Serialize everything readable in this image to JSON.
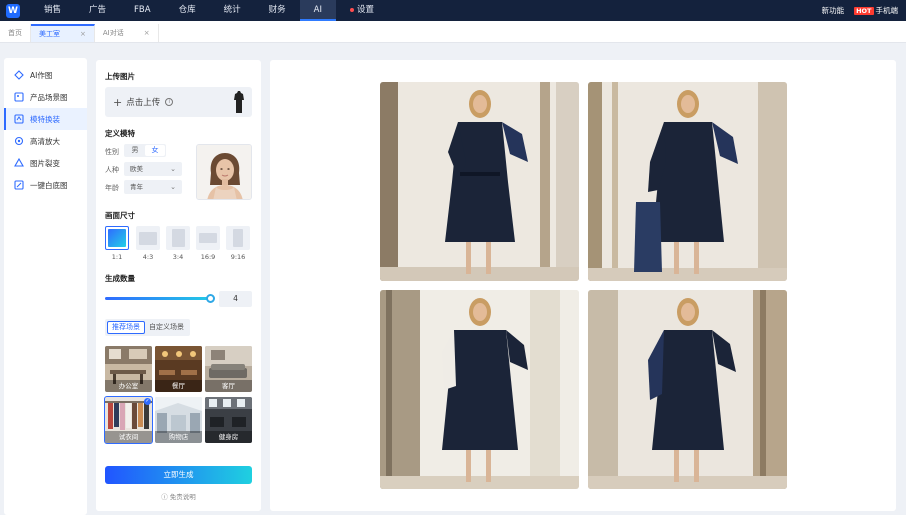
{
  "topnav": {
    "items": [
      {
        "label": "销售"
      },
      {
        "label": "广告"
      },
      {
        "label": "FBA"
      },
      {
        "label": "仓库"
      },
      {
        "label": "统计"
      },
      {
        "label": "财务"
      },
      {
        "label": "AI"
      },
      {
        "label": "设置"
      }
    ],
    "active": "AI",
    "right": {
      "new_feature": "新功能",
      "hot_badge": "HOT",
      "mobile": "手机端"
    }
  },
  "tabs": [
    {
      "label": "首页"
    },
    {
      "label": "美工室",
      "closable": true
    },
    {
      "label": "AI对话",
      "closable": true
    }
  ],
  "active_tab": "美工室",
  "sidebar": {
    "items": [
      {
        "label": "AI作图",
        "icon": "ai-draw-icon"
      },
      {
        "label": "产品场景图",
        "icon": "product-scene-icon"
      },
      {
        "label": "模特换装",
        "icon": "model-swap-icon"
      },
      {
        "label": "高清放大",
        "icon": "upscale-icon"
      },
      {
        "label": "图片裂变",
        "icon": "image-fission-icon"
      },
      {
        "label": "一键白底图",
        "icon": "white-bg-icon"
      }
    ],
    "active": "模特换装"
  },
  "config": {
    "upload_title": "上传图片",
    "upload_label": "点击上传",
    "model_title": "定义模特",
    "gender_label": "性别",
    "gender_options": [
      "男",
      "女"
    ],
    "gender_selected": "女",
    "race_label": "人种",
    "race_value": "欧美",
    "age_label": "年龄",
    "age_value": "青年",
    "size_title": "画面尺寸",
    "ratios": [
      "1:1",
      "4:3",
      "3:4",
      "16:9",
      "9:16"
    ],
    "ratio_selected": "1:1",
    "count_title": "生成数量",
    "count_value": "4",
    "count_fraction": 1.0,
    "scene_tabs": [
      "推荐场景",
      "自定义场景"
    ],
    "scene_tab_selected": "推荐场景",
    "scenes": [
      {
        "label": "办公室"
      },
      {
        "label": "餐厅"
      },
      {
        "label": "客厅"
      },
      {
        "label": "试衣间",
        "selected": true
      },
      {
        "label": "购物店"
      },
      {
        "label": "健身房"
      }
    ],
    "generate_label": "立即生成",
    "disclaimer": "免责说明"
  },
  "colors": {
    "nav_bg": "#14223d",
    "accent": "#2f6bff",
    "gradient_end": "#1fd0e0",
    "dress": "#1b2438",
    "cardigan": "#25345a"
  }
}
